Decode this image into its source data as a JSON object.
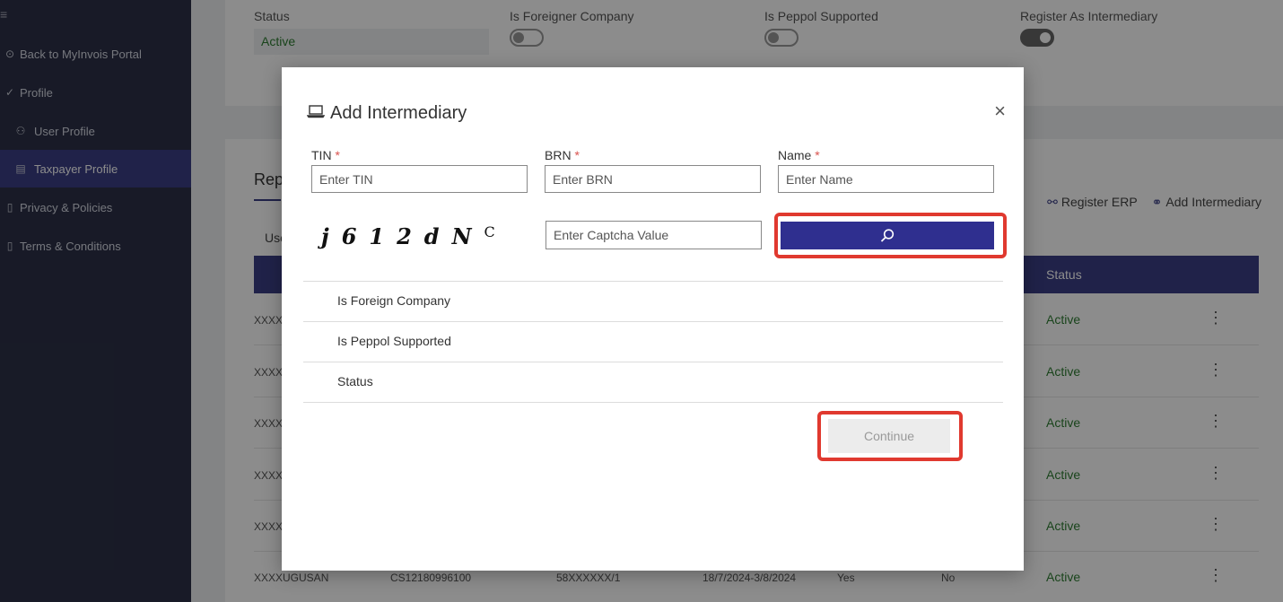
{
  "sidebar": {
    "menu_icon": "≡",
    "items": [
      {
        "label": "Back to MyInvois Portal",
        "icon": "back-circle-icon",
        "glyph": "⊙"
      },
      {
        "label": "Profile",
        "icon": "check-icon",
        "glyph": "✓"
      },
      {
        "label": "User Profile",
        "icon": "user-icon",
        "glyph": "⚇"
      },
      {
        "label": "Taxpayer Profile",
        "icon": "document-icon",
        "glyph": "▤"
      },
      {
        "label": "Privacy & Policies",
        "icon": "document-icon",
        "glyph": "▯"
      },
      {
        "label": "Terms & Conditions",
        "icon": "document-icon",
        "glyph": "▯"
      }
    ]
  },
  "status_card": {
    "status_label": "Status",
    "status_value": "Active",
    "foreigner_label": "Is Foreigner Company",
    "peppol_label": "Is Peppol Supported",
    "intermediary_label": "Register As Intermediary"
  },
  "list_card": {
    "title": "Rep",
    "tab": "Use",
    "register_erp": "Register ERP",
    "add_intermediary": "Add Intermediary",
    "status_header": "Status",
    "rows": [
      {
        "c0": "XXXXL",
        "status": "Active"
      },
      {
        "c0": "XXXXV",
        "status": "Active"
      },
      {
        "c0": "XXXXC",
        "status": "Active"
      },
      {
        "c0": "XXXXE",
        "status": "Active"
      },
      {
        "c0": "XXXXA",
        "status": "Active"
      },
      {
        "c0": "XXXXUGUSAN",
        "c1": "CS12180996100",
        "c2": "58XXXXXX/1",
        "c3": "18/7/2024-3/8/2024",
        "c4": "Yes",
        "c5": "No",
        "status": "Active"
      }
    ]
  },
  "modal": {
    "title": "Add Intermediary",
    "close": "×",
    "tin_label": "TIN",
    "tin_placeholder": "Enter TIN",
    "brn_label": "BRN",
    "brn_placeholder": "Enter BRN",
    "name_label": "Name",
    "name_placeholder": "Enter Name",
    "required_mark": "*",
    "captcha_chars": [
      "j",
      "6",
      "1",
      "2",
      "d",
      "N",
      "C"
    ],
    "captcha_placeholder": "Enter Captcha Value",
    "search_icon": "⚲",
    "info_rows": [
      "Is Foreign Company",
      "Is Peppol Supported",
      "Status"
    ],
    "continue_label": "Continue"
  },
  "colors": {
    "sidebar_bg": "#2c3147",
    "accent": "#3b3f86",
    "search_button": "#2f2f8f",
    "highlight": "#e0392f",
    "status_active": "#2e7d32"
  }
}
